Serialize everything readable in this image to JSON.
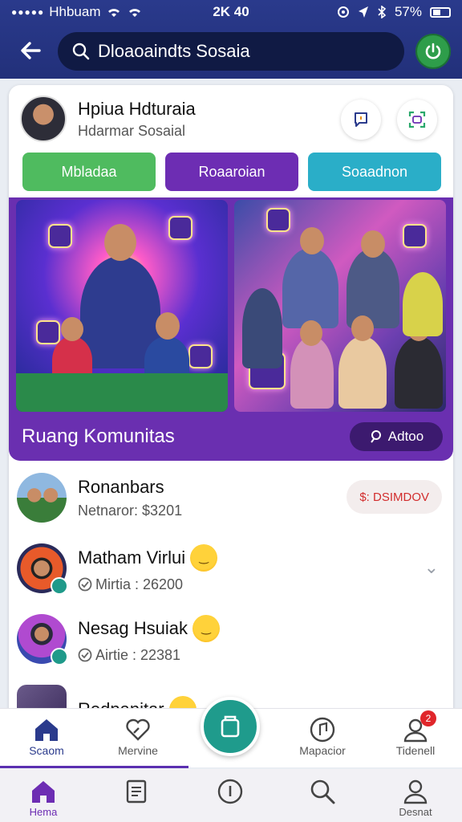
{
  "status_bar": {
    "carrier": "Hhbuam",
    "time": "2K 40",
    "battery": "57%"
  },
  "search": {
    "value": "Dloaoaindts Sosaia"
  },
  "profile": {
    "name": "Hpiua Hdturaia",
    "subtitle": "Hdarmar Sosaial"
  },
  "filters": [
    "Mbladaa",
    "Roaaroian",
    "Soaadnon"
  ],
  "hero": {
    "title": "Ruang Komunitas",
    "button": "Adtoo"
  },
  "list": [
    {
      "title": "Ronanbars",
      "meta": "Netnaror: $3201",
      "action": "$: DSIMDOV"
    },
    {
      "title": "Matham Virlui",
      "meta": "Mirtia : 26200"
    },
    {
      "title": "Nesag Hsuiak",
      "meta": "Airtie : 22381"
    },
    {
      "title": "Rednanitar"
    }
  ],
  "nav_top": [
    {
      "label": "Scaom",
      "icon": "home-icon"
    },
    {
      "label": "Mervine",
      "icon": "heart-icon"
    },
    {
      "label": "Mapacior",
      "icon": "music-icon"
    },
    {
      "label": "Tidenell",
      "icon": "user-icon",
      "badge": "2"
    }
  ],
  "nav_bottom": [
    {
      "label": "Hema",
      "icon": "home-icon"
    },
    {
      "label": "",
      "icon": "document-icon"
    },
    {
      "label": "",
      "icon": "info-icon"
    },
    {
      "label": "",
      "icon": "search-icon"
    },
    {
      "label": "Desnat",
      "icon": "profile-icon"
    }
  ],
  "colors": {
    "primary": "#2a3a8c",
    "accent": "#6d2db3",
    "teal": "#1f9b8c",
    "green": "#4fbb5f"
  }
}
